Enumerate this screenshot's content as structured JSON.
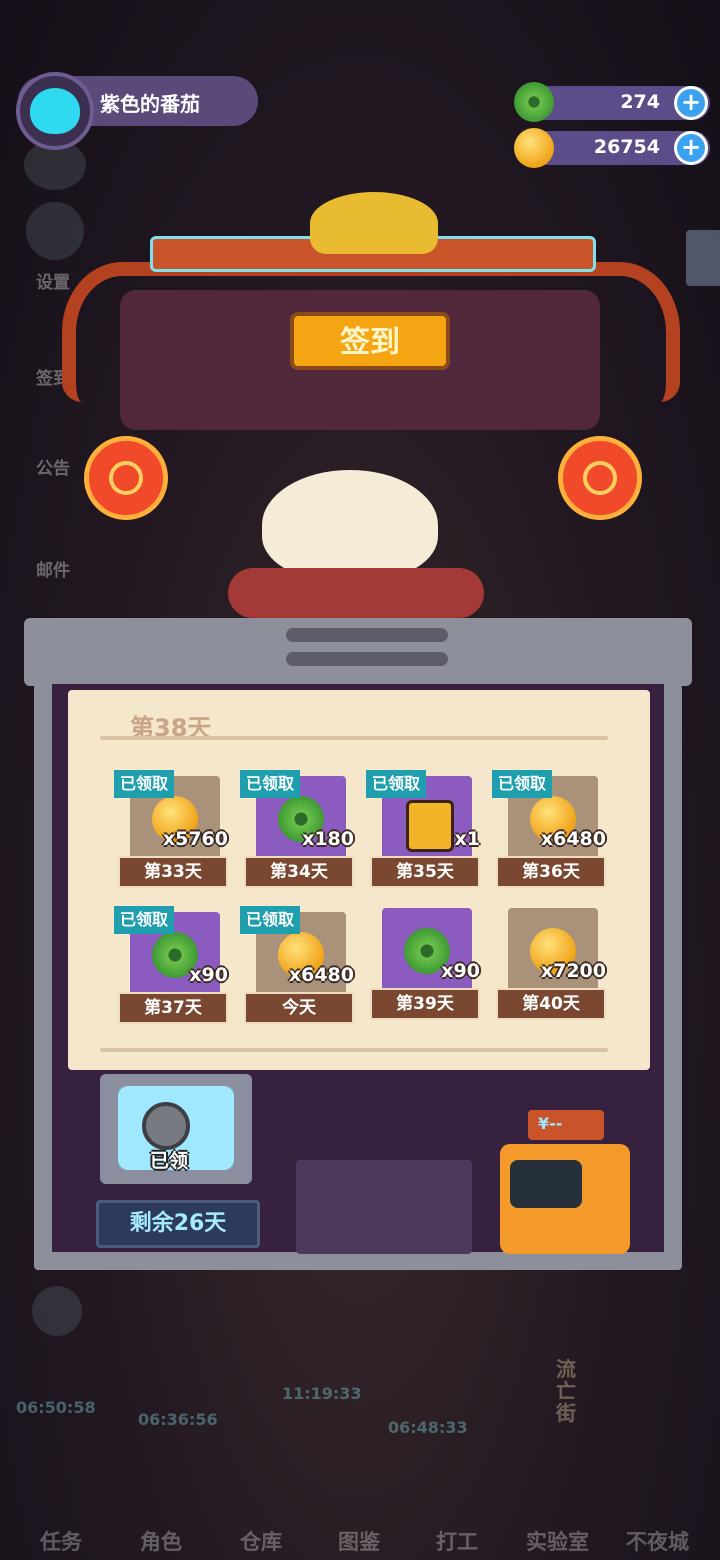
{
  "header": {
    "username": "紫色的番茄",
    "currencies": [
      {
        "icon": "green-gem-coin-icon",
        "value": "274"
      },
      {
        "icon": "gold-coin-icon",
        "value": "26754"
      }
    ]
  },
  "background": {
    "side_menu": [
      "设置",
      "签到",
      "公告",
      "邮件"
    ],
    "timers": [
      "06:50:58",
      "06:36:56",
      "11:19:33",
      "06:48:33"
    ],
    "nav_items": [
      "任务",
      "角色",
      "仓库",
      "图鉴",
      "打工",
      "实验室",
      "不夜城"
    ],
    "vertical_sign": "流亡街"
  },
  "signin": {
    "title": "签到",
    "day_title": "第38天",
    "claimed_label": "已领取",
    "rewards": [
      {
        "day": "第33天",
        "qty": "x5760",
        "icon": "gold-coin-icon",
        "claimed": true
      },
      {
        "day": "第34天",
        "qty": "x180",
        "icon": "green-gem-coin-icon",
        "claimed": true
      },
      {
        "day": "第35天",
        "qty": "x1",
        "icon": "battery-icon",
        "claimed": true
      },
      {
        "day": "第36天",
        "qty": "x6480",
        "icon": "gold-coin-icon",
        "claimed": true
      },
      {
        "day": "第37天",
        "qty": "x90",
        "icon": "green-gem-coin-icon",
        "claimed": true
      },
      {
        "day": "今天",
        "qty": "x6480",
        "icon": "gold-coin-icon",
        "claimed": true
      },
      {
        "day": "第39天",
        "qty": "x90",
        "icon": "green-gem-coin-icon",
        "claimed": false
      },
      {
        "day": "第40天",
        "qty": "x7200",
        "icon": "gold-coin-icon",
        "claimed": false
      }
    ],
    "monthly_card_status": "已领",
    "remaining": "剩余26天",
    "robot_display": "¥--"
  },
  "colors": {
    "accent": "#3aa2f0",
    "claimed_badge": "#1f9fae",
    "paper": "#f5e7cc",
    "sign": "#f5a514"
  }
}
